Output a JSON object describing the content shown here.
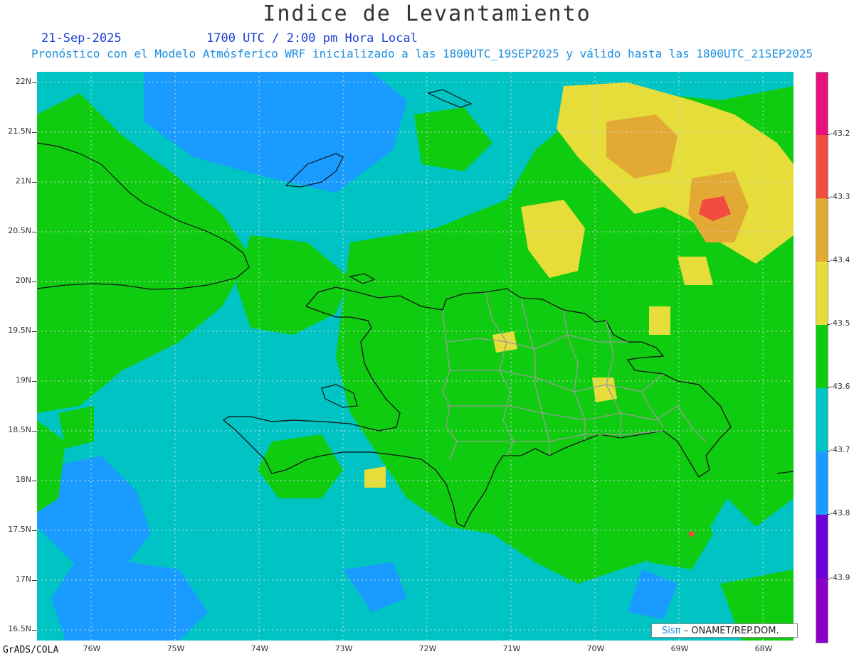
{
  "title": "Indice de Levantamiento",
  "date": "21-Sep-2025",
  "time": "1700 UTC / 2:00 pm Hora Local",
  "subtitle": "Pronóstico con el Modelo Atmósferico WRF inicializado a las 1800UTC_19SEP2025 y válido hasta las  1800UTC_21SEP2025",
  "lat_labels": [
    "22N",
    "21.5N",
    "21N",
    "20.5N",
    "20N",
    "19.5N",
    "19N",
    "18.5N",
    "18N",
    "17.5N",
    "17N",
    "16.5N"
  ],
  "lon_labels": [
    "76W",
    "75W",
    "74W",
    "73W",
    "72W",
    "71W",
    "70W",
    "69W",
    "68W"
  ],
  "colorbar": {
    "labels": [
      "-43.2",
      "-43.3",
      "-43.4",
      "-43.5",
      "-43.6",
      "-43.7",
      "-43.8",
      "-43.9"
    ],
    "colors": [
      "#e8107a",
      "#f24b3f",
      "#e2aa34",
      "#e6dc3a",
      "#10cc10",
      "#00c4c4",
      "#1a9bff",
      "#6a00d8",
      "#8a00c8"
    ]
  },
  "footer_left": "GrADS/COLA",
  "credit_logo": "Sisπ",
  "credit_org": " – ONAMET/REP.DOM."
}
